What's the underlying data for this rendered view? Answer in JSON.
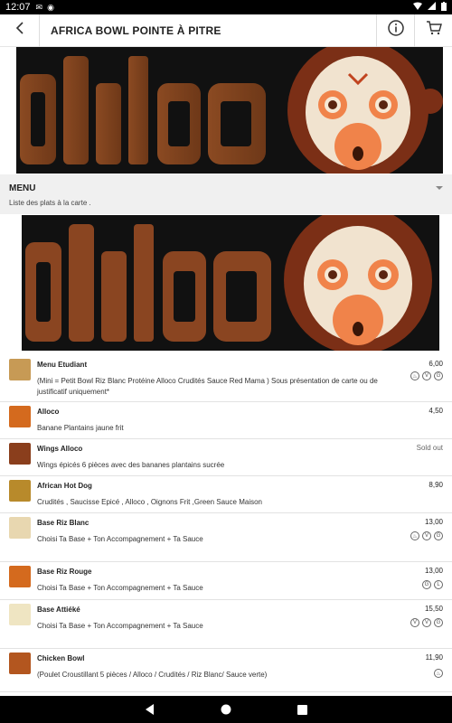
{
  "status_bar": {
    "time": "12:07"
  },
  "app_bar": {
    "title": "AFRICA BOWL POINTE À PITRE"
  },
  "menu_section": {
    "title": "MENU",
    "subtitle": "Liste des plats à la carte ."
  },
  "items": [
    {
      "name": "Menu Etudiant",
      "price": "6,00",
      "description": "(Mini = Petit Bowl Riz Blanc Protéine Alloco Crudités Sauce Red Mama ) Sous présentation de carte ou de justificatif uniquement*",
      "thumb": "#c79a55"
    },
    {
      "name": "Alloco",
      "price": "4,50",
      "description": "Banane Plantains jaune frit",
      "thumb": "#d46a1e"
    },
    {
      "name": "Wings Alloco",
      "price": "Sold out",
      "description": "Wings épicés 6 pièces avec des bananes plantains sucrée",
      "thumb": "#8a3e1c"
    },
    {
      "name": "African Hot Dog",
      "price": "8,90",
      "description": "Crudités , Saucisse Epicé , Alloco , Oignons Frit ,Green Sauce Maison",
      "thumb": "#b88a2b"
    },
    {
      "name": "Base Riz Blanc",
      "price": "13,00",
      "description": "Choisi Ta Base + Ton Accompagnement + Ta Sauce",
      "thumb": "#e8d7b0"
    },
    {
      "name": "Base Riz Rouge",
      "price": "13,00",
      "description": "Choisi Ta Base + Ton Accompagnement + Ta Sauce",
      "thumb": "#d46a1e"
    },
    {
      "name": "Base Attiéké",
      "price": "15,50",
      "description": "Choisi Ta Base + Ton Accompagnement + Ta Sauce",
      "thumb": "#efe5c2"
    },
    {
      "name": "Chicken Bowl",
      "price": "11,90",
      "description": "(Poulet Croustillant 5 pièces / Alloco / Crudités / Riz Blanc/ Sauce verte)",
      "thumb": "#b3561f"
    }
  ]
}
